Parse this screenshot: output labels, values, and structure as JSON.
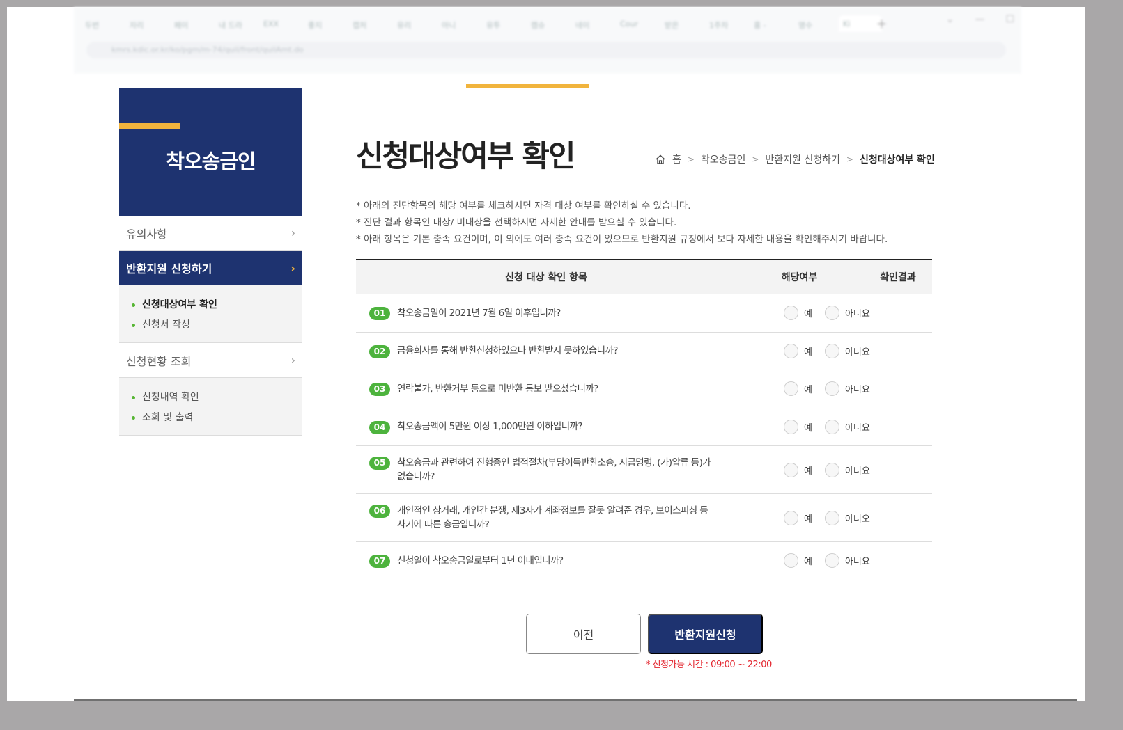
{
  "browser": {
    "tabs": [
      "두번",
      "자리",
      "페이",
      "내 드라",
      "EXX",
      "좋지",
      "캡처",
      "유리",
      "아니",
      "유투",
      "캠슈",
      "네이",
      "Cour",
      "받은",
      "1주차",
      "홍 -",
      "영수",
      "Ki"
    ],
    "url": "kmrs.kdic.or.kr/ko/pgm/m-74/quil/front/quilAmt.do"
  },
  "sidebar": {
    "title": "착오송금인",
    "items": [
      {
        "label": "유의사항"
      },
      {
        "label": "반환지원 신청하기",
        "sub": [
          "신청대상여부 확인",
          "신청서 작성"
        ]
      },
      {
        "label": "신청현황 조회",
        "sub": [
          "신청내역 확인",
          "조회 및 출력"
        ]
      }
    ]
  },
  "page": {
    "title": "신청대상여부 확인",
    "breadcrumb": [
      "홈",
      "착오송금인",
      "반환지원 신청하기",
      "신청대상여부 확인"
    ],
    "notes": [
      "아래의 진단항목의 해당 여부를 체크하시면 자격 대상 여부를 확인하실 수 있습니다.",
      "진단 결과 항목인 대상/ 비대상을 선택하시면 자세한 안내를 받으실 수 있습니다.",
      "아래 항목은 기본 충족 요건이며, 이 외에도 여러 충족 요건이 있으므로 반환지원 규정에서 보다 자세한 내용을 확인해주시기 바랍니다."
    ]
  },
  "table": {
    "headers": [
      "신청 대상 확인 항목",
      "해당여부",
      "확인결과"
    ],
    "rows": [
      {
        "num": "01",
        "text": "착오송금일이 2021년 7월 6일 이후입니까?",
        "yes": "예",
        "no": "아니요"
      },
      {
        "num": "02",
        "text": "금융회사를 통해 반환신청하였으나 반환받지 못하였습니까?",
        "yes": "예",
        "no": "아니요"
      },
      {
        "num": "03",
        "text": "연락불가, 반환거부 등으로 미반환 통보 받으셨습니까?",
        "yes": "예",
        "no": "아니요"
      },
      {
        "num": "04",
        "text": "착오송금액이 5만원 이상 1,000만원 이하입니까?",
        "yes": "예",
        "no": "아니요"
      },
      {
        "num": "05",
        "text": "착오송금과 관련하여 진행중인 법적절차(부당이득반환소송, 지급명령, (가)압류 등)가 없습니까?",
        "yes": "예",
        "no": "아니요"
      },
      {
        "num": "06",
        "text": "개인적인 상거래, 개인간 분쟁, 제3자가 계좌정보를 잘못 알려준 경우, 보이스피싱 등 사기에 따른 송금입니까?",
        "yes": "예",
        "no": "아니오"
      },
      {
        "num": "07",
        "text": "신청일이 착오송금일로부터 1년 이내입니까?",
        "yes": "예",
        "no": "아니요"
      }
    ]
  },
  "buttons": {
    "prev": "이전",
    "apply": "반환지원신청"
  },
  "hours_note": "* 신청가능 시간 : 09:00 ~ 22:00",
  "colors": {
    "navy": "#1e3370",
    "accent": "#f1b43d",
    "green": "#4db33d",
    "red": "#e3252e"
  }
}
